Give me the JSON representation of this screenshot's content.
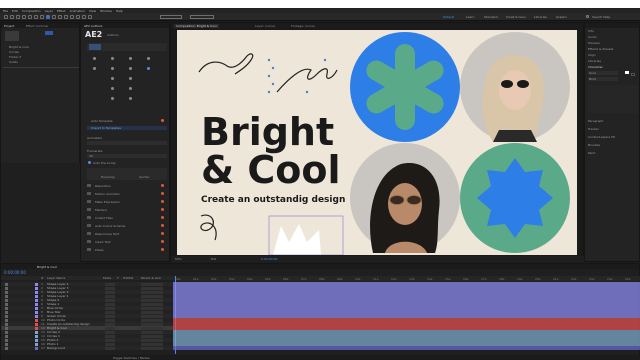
{
  "menu": [
    "File",
    "Edit",
    "Composition",
    "Layer",
    "Effect",
    "Animation",
    "View",
    "Window",
    "Help"
  ],
  "workspaces": [
    "Default",
    "Learn",
    "Standard",
    "Small Screen",
    "Libraries",
    "Graphs"
  ],
  "active_workspace": "Default",
  "search_help": "Search Help",
  "project_panel": {
    "tabs": [
      "Project",
      "Effect Controls"
    ],
    "items": [
      "Bright & Cool",
      "Circles",
      "Folder 2",
      "Solids"
    ]
  },
  "ae2_panel": {
    "tab": "AE2 Authors",
    "title": "AE2",
    "link": "Authors",
    "items": [
      "Auto Template",
      "Import In Templates"
    ],
    "section_label": "Animation",
    "framerate_label": "Framerate",
    "framerate_value": "30",
    "auto_precomp": "Auto Pre-Comp",
    "mode_left": "Hovering",
    "mode_right": "Anchor",
    "features": [
      "Resolution",
      "Motion Animator",
      "Make Expression",
      "Markers",
      "Collect Files",
      "Auto Colors Scheme",
      "Responsive Text",
      "Insert Text",
      "Pixels"
    ]
  },
  "viewer": {
    "tabs": [
      "Composition: Bright & Cool",
      "Layer: (none)",
      "Footage: (none)"
    ],
    "headline_line1": "Bright",
    "headline_line2": "& Cool",
    "subtitle": "Create an outstandig design",
    "zoom": "50%",
    "quality": "Full",
    "timecode": "0:00:00:00",
    "colors": {
      "canvas": "#eee6d8",
      "blue": "#2d7ee6",
      "green": "#5aaa8a",
      "dark": "#1a1a1a",
      "photo_gray": "#c9c5c0"
    }
  },
  "right_panel": {
    "items": [
      "Info",
      "Audio",
      "Preview",
      "Effects & Presets",
      "Align",
      "Libraries",
      "Character",
      "Paragraph",
      "Tracker",
      "Content-Aware Fill",
      "Brushes",
      "Paint"
    ],
    "font": "Sora",
    "font_style": "Bold"
  },
  "timeline": {
    "comp_tab": "Bright & Cool",
    "timecode": "0:00:00:00",
    "columns": [
      "#",
      "Layer Name",
      "Mode",
      "T",
      "TrkMat",
      "Parent & Link"
    ],
    "layers": [
      {
        "num": "1",
        "name": "Shape Layer 4",
        "color": "#8a8af0"
      },
      {
        "num": "2",
        "name": "Shape Layer 3",
        "color": "#8a8af0"
      },
      {
        "num": "3",
        "name": "Shape Layer 2",
        "color": "#8a8af0"
      },
      {
        "num": "4",
        "name": "Shape Layer 1",
        "color": "#8a8af0"
      },
      {
        "num": "5",
        "name": "Shape 2",
        "color": "#8a8af0"
      },
      {
        "num": "6",
        "name": "Shape 1",
        "color": "#8a8af0"
      },
      {
        "num": "7",
        "name": "Blue Circle",
        "color": "#8a8af0"
      },
      {
        "num": "8",
        "name": "Blue Star",
        "color": "#8a8af0"
      },
      {
        "num": "9",
        "name": "Green Circle",
        "color": "#8a8af0"
      },
      {
        "num": "10",
        "name": "Photo Circle",
        "color": "#e04f4f"
      },
      {
        "num": "11",
        "name": "Create an outstandig design",
        "color": "#e04f4f"
      },
      {
        "num": "12",
        "name": "Bright & Cool",
        "color": "#e04f4f"
      },
      {
        "num": "13",
        "name": "Circles 2",
        "color": "#7ea8c9"
      },
      {
        "num": "14",
        "name": "Circles 1",
        "color": "#7ea8c9"
      },
      {
        "num": "15",
        "name": "Photo 2",
        "color": "#7ea8c9"
      },
      {
        "num": "16",
        "name": "Photo 1",
        "color": "#7ea8c9"
      },
      {
        "num": "17",
        "name": "Background",
        "color": "#6a6ad0"
      }
    ],
    "ticks": [
      "00s",
      "01s",
      "02s",
      "03s",
      "04s",
      "05s",
      "06s",
      "07s",
      "08s",
      "09s",
      "10s",
      "11s",
      "12s",
      "13s",
      "14s",
      "15s",
      "16s",
      "17s",
      "18s",
      "19s",
      "20s",
      "21s",
      "22s",
      "23s",
      "24s",
      "25s"
    ],
    "footer": "Toggle Switches / Modes"
  }
}
